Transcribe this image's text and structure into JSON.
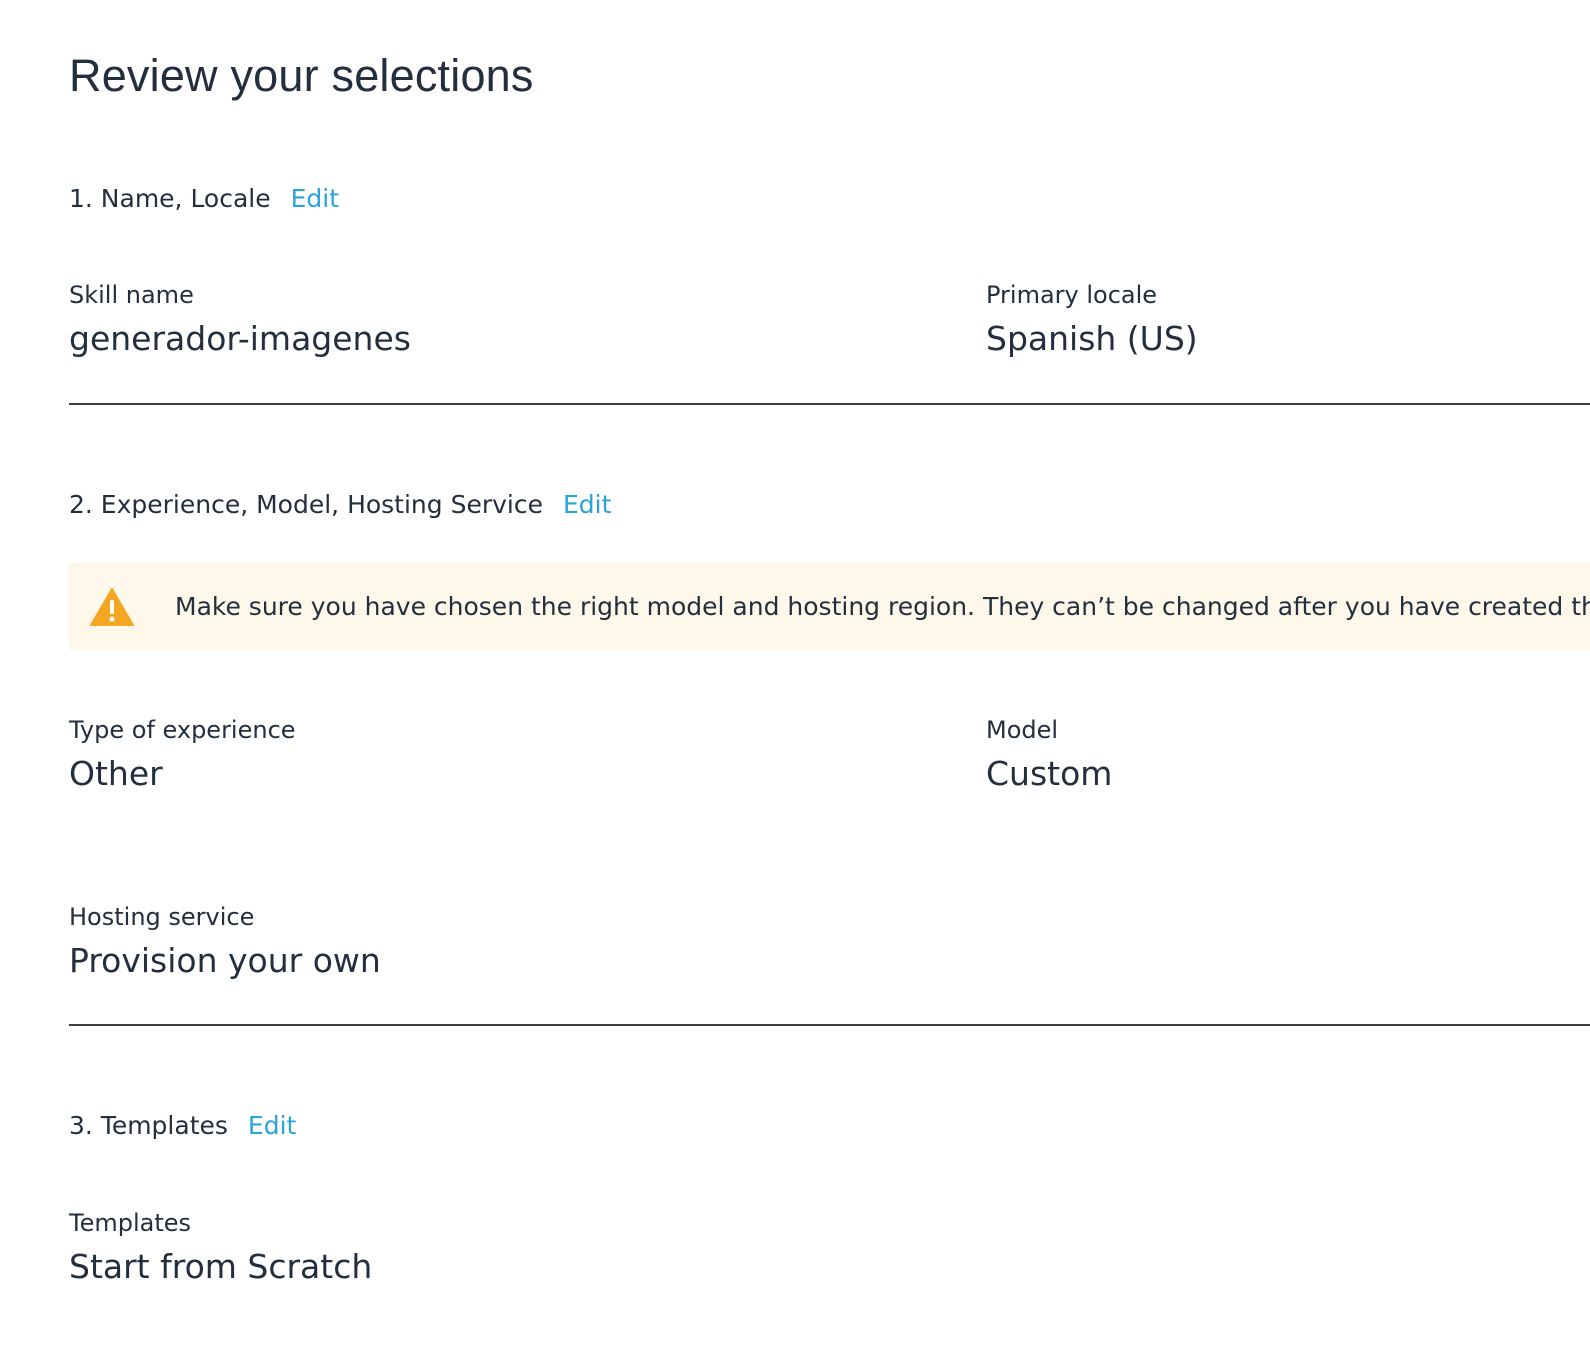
{
  "page": {
    "title": "Review your selections"
  },
  "sections": [
    {
      "heading": "1. Name, Locale",
      "edit_label": "Edit",
      "fields": [
        {
          "label": "Skill name",
          "value": "generador-imagenes"
        },
        {
          "label": "Primary locale",
          "value": "Spanish (US)"
        }
      ]
    },
    {
      "heading": "2. Experience, Model, Hosting Service",
      "edit_label": "Edit",
      "alert": {
        "icon": "warning-icon",
        "text": "Make sure you have chosen the right model and hosting region. They can’t be changed after you have created the skill."
      },
      "fields": [
        {
          "label": "Type of experience",
          "value": "Other"
        },
        {
          "label": "Model",
          "value": "Custom"
        },
        {
          "label": "Hosting service",
          "value": "Provision your own"
        }
      ]
    },
    {
      "heading": "3. Templates",
      "edit_label": "Edit",
      "fields": [
        {
          "label": "Templates",
          "value": "Start from Scratch"
        }
      ]
    }
  ],
  "colors": {
    "text": "#232f3e",
    "link": "#2aa3d8",
    "alert_background": "#fdf8e9",
    "warning_icon": "#f5a623",
    "divider": "#3a3f44"
  }
}
